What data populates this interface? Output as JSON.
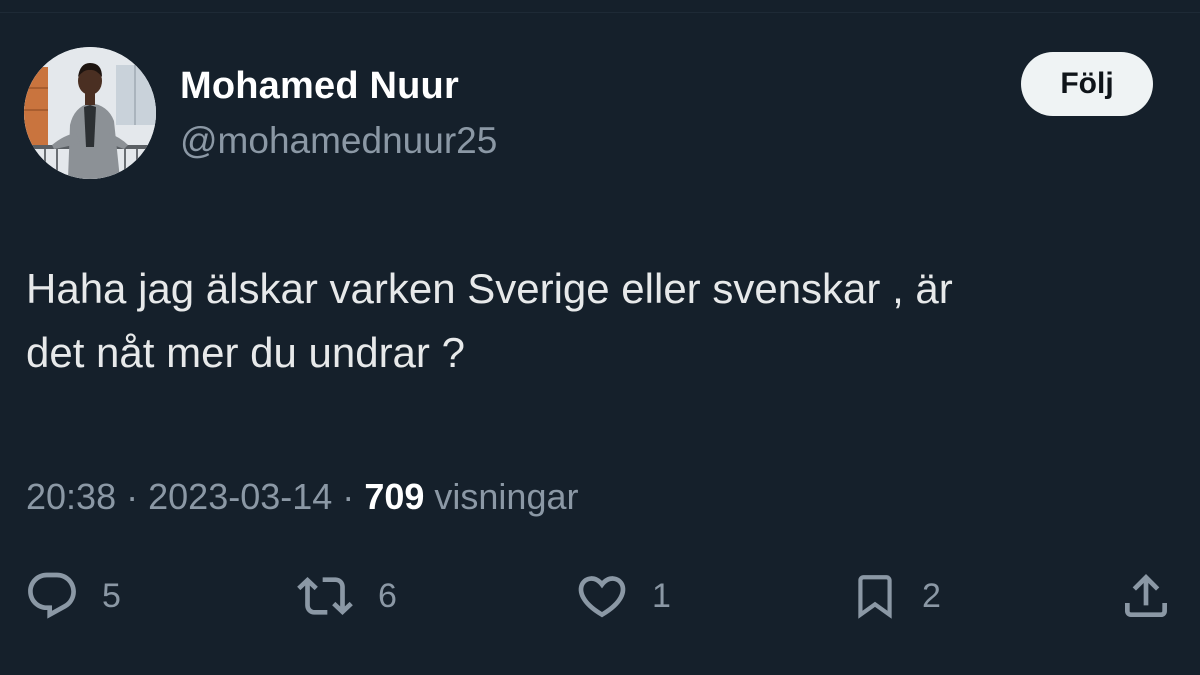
{
  "tweet": {
    "author": {
      "display_name": "Mohamed Nuur",
      "handle": "@mohamednuur25",
      "avatar_icon": "profile-photo"
    },
    "follow_label": "Följ",
    "text_lines": [
      "Haha jag älskar varken Sverige eller svenskar , är",
      "det nåt mer du undrar ?"
    ],
    "meta": {
      "time": "20:38",
      "separator": "·",
      "date": "2023-03-14",
      "views_count": "709",
      "views_label": "visningar"
    },
    "actions": {
      "reply": {
        "icon": "reply-icon",
        "count": "5"
      },
      "retweet": {
        "icon": "retweet-icon",
        "count": "6"
      },
      "like": {
        "icon": "heart-icon",
        "count": "1"
      },
      "bookmark": {
        "icon": "bookmark-icon",
        "count": "2"
      },
      "share": {
        "icon": "share-icon"
      }
    }
  },
  "colors": {
    "background": "#15202b",
    "primary_text": "#e7e9ea",
    "secondary_text": "#8b98a5",
    "follow_button_bg": "#eff3f4",
    "follow_button_text": "#0f1419"
  }
}
